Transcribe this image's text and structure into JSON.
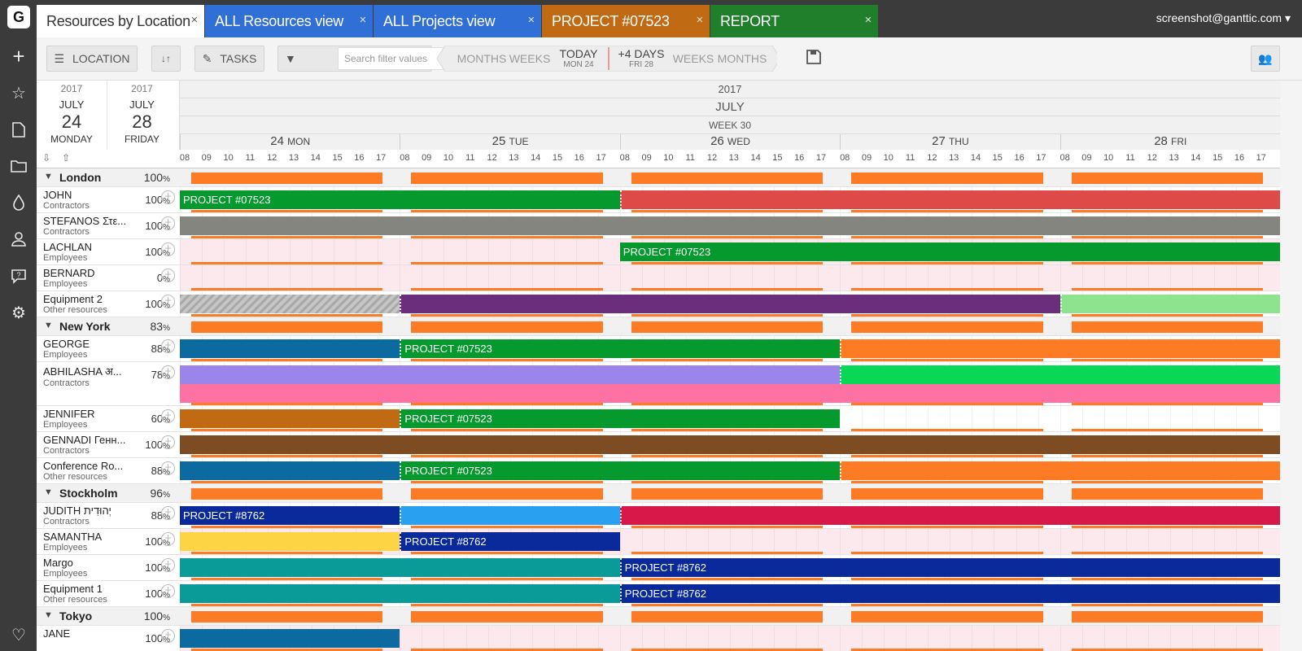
{
  "user_email": "screenshot@ganttic.com",
  "rail_icons": [
    "logo",
    "plus-icon",
    "star-icon",
    "document-icon",
    "folder-icon",
    "drop-icon",
    "user-icon",
    "help-icon",
    "gear-icon",
    "heart-icon"
  ],
  "logo_letter": "G",
  "tabs": [
    {
      "label": "Resources by Location",
      "bg": "#ffffff",
      "fg": "#333333"
    },
    {
      "label": "ALL Resources view",
      "bg": "#2f6fd6",
      "fg": "#ffffff"
    },
    {
      "label": "ALL Projects view",
      "bg": "#2f6fd6",
      "fg": "#ffffff"
    },
    {
      "label": "PROJECT #07523",
      "bg": "#c06a14",
      "fg": "#ffffff"
    },
    {
      "label": "REPORT",
      "bg": "#1f7f2a",
      "fg": "#ffffff"
    }
  ],
  "toolbar": {
    "location_label": "LOCATION",
    "tasks_label": "TASKS",
    "search_placeholder": "Search filter values",
    "months_left": "MONTHS",
    "weeks_left": "WEEKS",
    "today": "TODAY",
    "today_sub": "MON 24",
    "plus_days": "+4 DAYS",
    "plus_days_sub": "FRI 28",
    "weeks_right": "WEEKS",
    "months_right": "MONTHS"
  },
  "date_range": {
    "start": {
      "year": "2017",
      "month": "JULY",
      "day": "24",
      "weekday": "MONDAY"
    },
    "end": {
      "year": "2017",
      "month": "JULY",
      "day": "28",
      "weekday": "FRIDAY"
    }
  },
  "header": {
    "year": "2017",
    "month": "JULY",
    "week": "WEEK 30",
    "days": [
      {
        "num": "24",
        "name": "MON"
      },
      {
        "num": "25",
        "name": "TUE"
      },
      {
        "num": "26",
        "name": "WED"
      },
      {
        "num": "27",
        "name": "THU"
      },
      {
        "num": "28",
        "name": "FRI"
      }
    ],
    "hours": [
      "08",
      "09",
      "10",
      "11",
      "12",
      "13",
      "14",
      "15",
      "16",
      "17"
    ]
  },
  "rows": [
    {
      "kind": "group",
      "name": "London",
      "pct": "100"
    },
    {
      "kind": "res",
      "name": "JOHN",
      "type": "Contractors",
      "pct": "100",
      "pink": false,
      "bars": [
        {
          "s": 0,
          "e": 0.4,
          "c": "#069a2e",
          "t": "PROJECT #07523"
        },
        {
          "s": 0.4,
          "e": 1,
          "c": "#dd4a48",
          "t": ""
        }
      ]
    },
    {
      "kind": "res",
      "name": "STEFANOS Στε...",
      "type": "Contractors",
      "pct": "100",
      "pink": false,
      "bars": [
        {
          "s": 0,
          "e": 1,
          "c": "#858580",
          "t": ""
        }
      ]
    },
    {
      "kind": "res",
      "name": "LACHLAN",
      "type": "Employees",
      "pct": "100",
      "pink": true,
      "bars": [
        {
          "s": 0.4,
          "e": 1,
          "c": "#069a2e",
          "t": "PROJECT #07523"
        }
      ]
    },
    {
      "kind": "res",
      "name": "BERNARD",
      "type": "Employees",
      "pct": "0",
      "pink": true,
      "bars": []
    },
    {
      "kind": "res",
      "name": "Equipment 2",
      "type": "Other resources",
      "pct": "100",
      "pink": false,
      "bars": [
        {
          "s": 0,
          "e": 0.2,
          "c": "#b5b5b5",
          "t": ""
        },
        {
          "s": 0.2,
          "e": 0.8,
          "c": "#6b2e7c",
          "t": ""
        },
        {
          "s": 0.8,
          "e": 1,
          "c": "#8ee48e",
          "t": ""
        }
      ]
    },
    {
      "kind": "group",
      "name": "New York",
      "pct": "83"
    },
    {
      "kind": "res",
      "name": "GEORGE",
      "type": "Employees",
      "pct": "88",
      "pink": false,
      "bars": [
        {
          "s": 0,
          "e": 0.2,
          "c": "#0d6aa0",
          "t": ""
        },
        {
          "s": 0.2,
          "e": 0.6,
          "c": "#069a2e",
          "t": "PROJECT #07523"
        },
        {
          "s": 0.6,
          "e": 1,
          "c": "#fc7b24",
          "t": ""
        }
      ]
    },
    {
      "kind": "res",
      "name": "ABHILASHA अ...",
      "type": "Contractors",
      "pct": "78",
      "pink": false,
      "tall": true,
      "bars": [
        {
          "s": 0,
          "e": 0.6,
          "c": "#9b84ea",
          "t": ""
        },
        {
          "s": 0.6,
          "e": 1,
          "c": "#08d855",
          "t": ""
        }
      ],
      "bars2": [
        {
          "s": 0,
          "e": 1,
          "c": "#fd72a3",
          "t": ""
        }
      ]
    },
    {
      "kind": "res",
      "name": "JENNIFER",
      "type": "Employees",
      "pct": "60",
      "pink": false,
      "bars": [
        {
          "s": 0,
          "e": 0.2,
          "c": "#c06a14",
          "t": ""
        },
        {
          "s": 0.2,
          "e": 0.6,
          "c": "#069a2e",
          "t": "PROJECT #07523"
        }
      ]
    },
    {
      "kind": "res",
      "name": "GENNADI Генн...",
      "type": "Contractors",
      "pct": "100",
      "pink": false,
      "bars": [
        {
          "s": 0,
          "e": 1,
          "c": "#7d4c22",
          "t": ""
        }
      ]
    },
    {
      "kind": "res",
      "name": "Conference Ro...",
      "type": "Other resources",
      "pct": "88",
      "pink": false,
      "bars": [
        {
          "s": 0,
          "e": 0.2,
          "c": "#0d6aa0",
          "t": ""
        },
        {
          "s": 0.2,
          "e": 0.6,
          "c": "#069a2e",
          "t": "PROJECT #07523"
        },
        {
          "s": 0.6,
          "e": 1,
          "c": "#fc7b24",
          "t": ""
        }
      ]
    },
    {
      "kind": "group",
      "name": "Stockholm",
      "pct": "96"
    },
    {
      "kind": "res",
      "name": "JUDITH יְהוּדִית",
      "type": "Contractors",
      "pct": "88",
      "pink": false,
      "bars": [
        {
          "s": 0,
          "e": 0.2,
          "c": "#0a2a9c",
          "t": "PROJECT #8762"
        },
        {
          "s": 0.2,
          "e": 0.4,
          "c": "#2aa0f0",
          "t": ""
        },
        {
          "s": 0.4,
          "e": 1,
          "c": "#d9184a",
          "t": ""
        }
      ]
    },
    {
      "kind": "res",
      "name": "SAMANTHA",
      "type": "Employees",
      "pct": "100",
      "pink": true,
      "bars": [
        {
          "s": 0,
          "e": 0.2,
          "c": "#fdd444",
          "t": ""
        },
        {
          "s": 0.2,
          "e": 0.4,
          "c": "#0a2a9c",
          "t": "PROJECT #8762"
        }
      ]
    },
    {
      "kind": "res",
      "name": "Margo",
      "type": "Employees",
      "pct": "100",
      "pink": false,
      "bars": [
        {
          "s": 0,
          "e": 0.4,
          "c": "#0a9a98",
          "t": ""
        },
        {
          "s": 0.4,
          "e": 1,
          "c": "#0a2a9c",
          "t": "PROJECT #8762"
        }
      ]
    },
    {
      "kind": "res",
      "name": "Equipment 1",
      "type": "Other resources",
      "pct": "100",
      "pink": false,
      "bars": [
        {
          "s": 0,
          "e": 0.4,
          "c": "#0a9a98",
          "t": ""
        },
        {
          "s": 0.4,
          "e": 1,
          "c": "#0a2a9c",
          "t": "PROJECT #8762"
        }
      ]
    },
    {
      "kind": "group",
      "name": "Tokyo",
      "pct": "100"
    },
    {
      "kind": "res",
      "name": "JANE",
      "type": "",
      "pct": "100",
      "pink": true,
      "bars": [
        {
          "s": 0,
          "e": 0.2,
          "c": "#0d6aa0",
          "t": ""
        }
      ]
    }
  ]
}
